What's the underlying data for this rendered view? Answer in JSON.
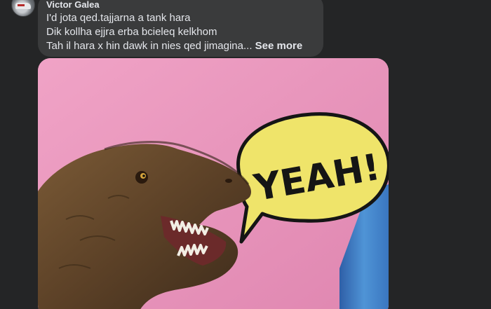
{
  "comment": {
    "author": "Victor Galea",
    "lines": [
      "I'd jota qed.tajjarna a tank hara",
      "Dik kollha ejjra erba bcieleq kelkhom",
      "Tah il hara x hin dawk in nies qed jimagina..."
    ],
    "see_more": "See more"
  },
  "photo": {
    "speech_text": "YEAH!",
    "colors": {
      "background_pink": "#e98fb8",
      "bubble_yellow": "#efe46a",
      "blue_block": "#3f7fc4"
    }
  }
}
